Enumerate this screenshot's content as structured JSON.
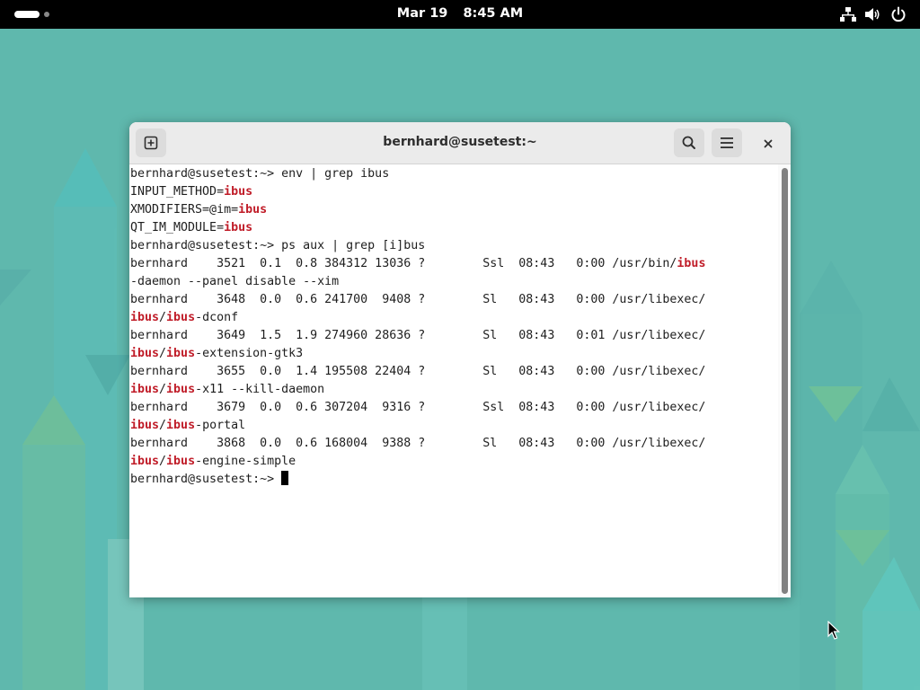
{
  "topbar": {
    "date": "Mar 19",
    "time": "8:45 AM",
    "icons": [
      "network-icon",
      "volume-icon",
      "power-icon"
    ]
  },
  "window": {
    "title": "bernhard@susetest:~",
    "icons": [
      "new-tab-icon",
      "search-icon",
      "hamburger-menu-icon",
      "close-icon"
    ]
  },
  "terminal": {
    "lines": [
      [
        {
          "t": "bernhard@susetest:~> env | grep ibus"
        }
      ],
      [
        {
          "t": "INPUT_METHOD="
        },
        {
          "t": "ibus",
          "h": 1
        }
      ],
      [
        {
          "t": "XMODIFIERS=@im="
        },
        {
          "t": "ibus",
          "h": 1
        }
      ],
      [
        {
          "t": "QT_IM_MODULE="
        },
        {
          "t": "ibus",
          "h": 1
        }
      ],
      [
        {
          "t": "bernhard@susetest:~> ps aux | grep [i]bus"
        }
      ],
      [
        {
          "t": "bernhard    3521  0.1  0.8 384312 13036 ?        Ssl  08:43   0:00 /usr/bin/"
        },
        {
          "t": "ibus",
          "h": 1
        }
      ],
      [
        {
          "t": "-daemon --panel disable --xim"
        }
      ],
      [
        {
          "t": "bernhard    3648  0.0  0.6 241700  9408 ?        Sl   08:43   0:00 /usr/libexec/"
        }
      ],
      [
        {
          "t": "ibus",
          "h": 1
        },
        {
          "t": "/"
        },
        {
          "t": "ibus",
          "h": 1
        },
        {
          "t": "-dconf"
        }
      ],
      [
        {
          "t": "bernhard    3649  1.5  1.9 274960 28636 ?        Sl   08:43   0:01 /usr/libexec/"
        }
      ],
      [
        {
          "t": "ibus",
          "h": 1
        },
        {
          "t": "/"
        },
        {
          "t": "ibus",
          "h": 1
        },
        {
          "t": "-extension-gtk3"
        }
      ],
      [
        {
          "t": "bernhard    3655  0.0  1.4 195508 22404 ?        Sl   08:43   0:00 /usr/libexec/"
        }
      ],
      [
        {
          "t": "ibus",
          "h": 1
        },
        {
          "t": "/"
        },
        {
          "t": "ibus",
          "h": 1
        },
        {
          "t": "-x11 --kill-daemon"
        }
      ],
      [
        {
          "t": "bernhard    3679  0.0  0.6 307204  9316 ?        Ssl  08:43   0:00 /usr/libexec/"
        }
      ],
      [
        {
          "t": "ibus",
          "h": 1
        },
        {
          "t": "/"
        },
        {
          "t": "ibus",
          "h": 1
        },
        {
          "t": "-portal"
        }
      ],
      [
        {
          "t": "bernhard    3868  0.0  0.6 168004  9388 ?        Sl   08:43   0:00 /usr/libexec/"
        }
      ],
      [
        {
          "t": "ibus",
          "h": 1
        },
        {
          "t": "/"
        },
        {
          "t": "ibus",
          "h": 1
        },
        {
          "t": "-engine-simple"
        }
      ],
      [
        {
          "t": "bernhard@susetest:~> "
        }
      ]
    ],
    "highlight_color": "#c01c28"
  }
}
